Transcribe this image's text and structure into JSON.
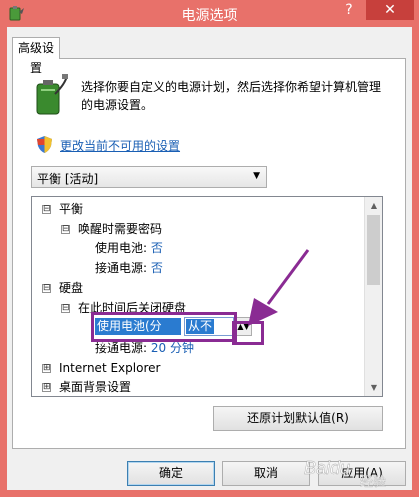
{
  "window": {
    "title": "电源选项",
    "help_label": "?",
    "close_label": "✕"
  },
  "tab": {
    "label": "高级设置"
  },
  "description": "选择你要自定义的电源计划，然后选择你希望计算机管理的电源设置。",
  "change_link": "更改当前不可用的设置",
  "plan_select": {
    "value": "平衡 [活动]"
  },
  "tree": {
    "items": [
      {
        "label": "平衡",
        "expander": "⊟"
      },
      {
        "label": "唤醒时需要密码",
        "expander": "⊟"
      },
      {
        "label": "使用电池:",
        "value": "否"
      },
      {
        "label": "接通电源:",
        "value": "否"
      },
      {
        "label": "硬盘",
        "expander": "⊟"
      },
      {
        "label": "在此时间后关闭硬盘",
        "expander": "⊟"
      },
      {
        "label": "使用电池(分钟):",
        "value": "从不"
      },
      {
        "label": "接通电源:",
        "value": "20 分钟"
      },
      {
        "label": "Internet Explorer",
        "expander": "⊞"
      },
      {
        "label": "桌面背景设置",
        "expander": "⊞"
      }
    ]
  },
  "restore_button": "还原计划默认值(R)",
  "buttons": {
    "ok": "确定",
    "cancel": "取消",
    "apply": "应用(A)"
  },
  "watermark": "Baidu 经验",
  "colors": {
    "accent": "#8a2b93",
    "title_bar": "#e8716a",
    "close": "#c7403c",
    "selection": "#2a7bd0"
  },
  "icons": [
    "power-options-icon",
    "battery-power-icon",
    "uac-shield-icon",
    "annotation-arrow"
  ]
}
